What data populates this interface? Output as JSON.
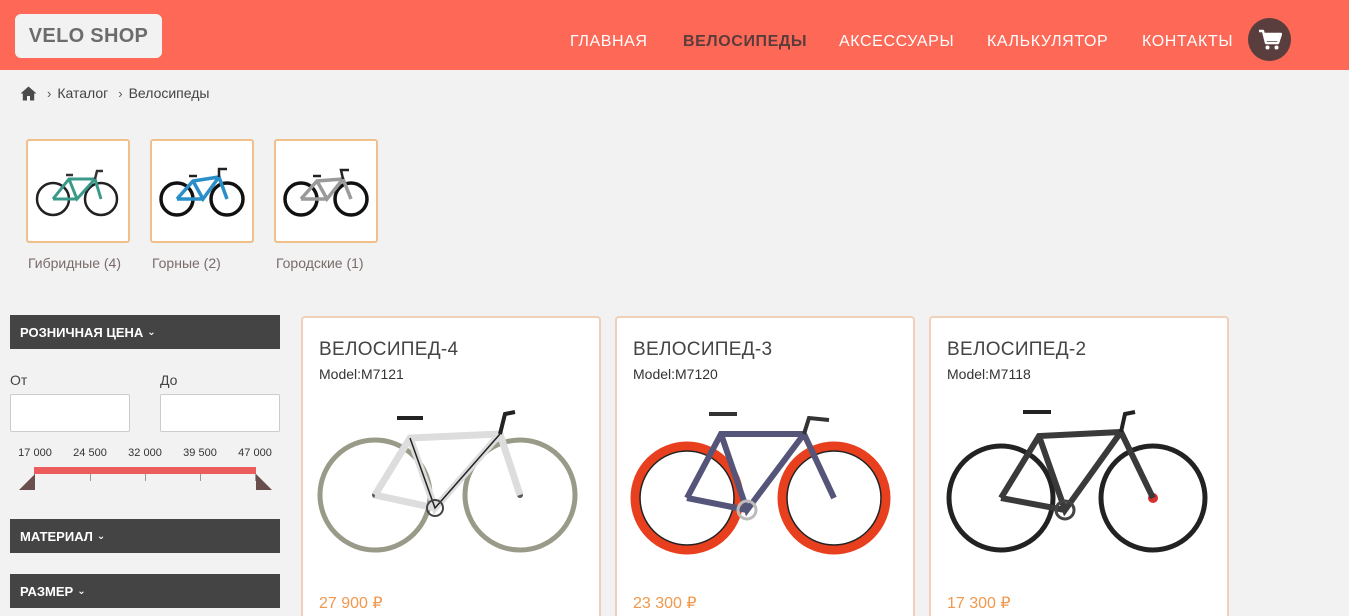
{
  "header": {
    "logo": "VELO SHOP",
    "nav": [
      {
        "label": "ГЛАВНАЯ",
        "active": false
      },
      {
        "label": "ВЕЛОСИПЕДЫ",
        "active": true
      },
      {
        "label": "АКСЕССУАРЫ",
        "active": false
      },
      {
        "label": "КАЛЬКУЛЯТОР",
        "active": false
      },
      {
        "label": "КОНТАКТЫ",
        "active": false
      }
    ],
    "cart_icon": "cart-icon"
  },
  "breadcrumb": {
    "home_icon": "home-icon",
    "items": [
      "Каталог",
      "Велосипеды"
    ]
  },
  "categories": [
    {
      "label": "Гибридные (4)"
    },
    {
      "label": "Горные (2)"
    },
    {
      "label": "Городские (1)"
    }
  ],
  "filters": {
    "price": {
      "title": "РОЗНИЧНАЯ ЦЕНА",
      "from_label": "От",
      "to_label": "До",
      "from_value": "",
      "to_value": "",
      "ticks": [
        "17 000",
        "24 500",
        "32 000",
        "39 500",
        "47 000"
      ],
      "range": [
        17000,
        47000
      ]
    },
    "material": {
      "title": "МАТЕРИАЛ"
    },
    "size": {
      "title": "РАЗМЕР"
    }
  },
  "products": [
    {
      "title": "ВЕЛОСИПЕД-4",
      "model": "Model:M7121",
      "price": "27 900 ₽"
    },
    {
      "title": "ВЕЛОСИПЕД-3",
      "model": "Model:M7120",
      "price": "23 300 ₽"
    },
    {
      "title": "ВЕЛОСИПЕД-2",
      "model": "Model:M7118",
      "price": "17 300 ₽"
    }
  ],
  "colors": {
    "header_bg": "#fe6857",
    "accent_price": "#f0984c",
    "filter_bg": "#444444",
    "range_track": "#ec5c5c",
    "cart_bg": "#5a3e3e"
  }
}
